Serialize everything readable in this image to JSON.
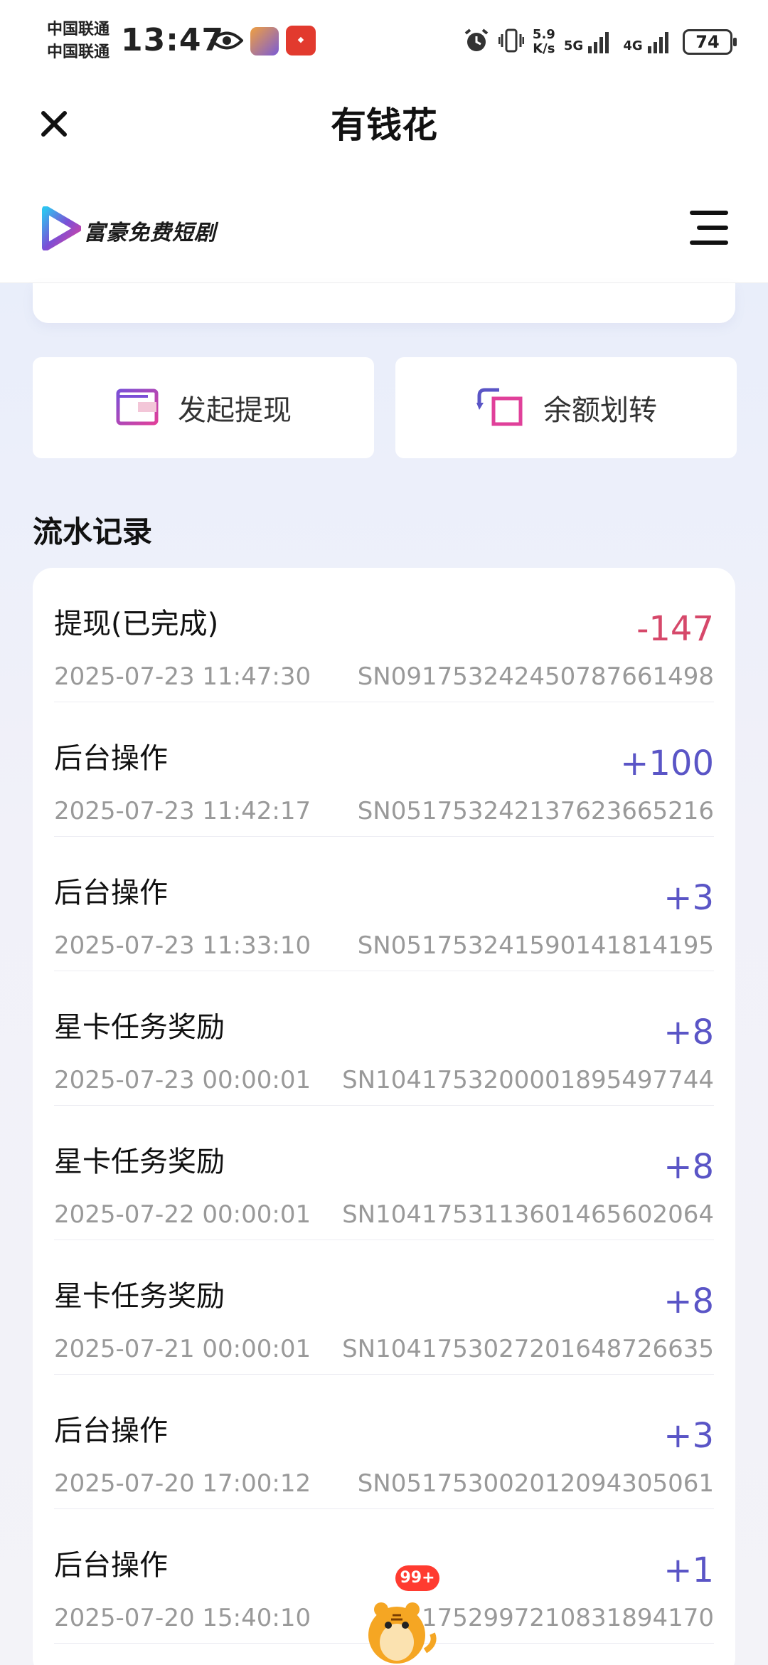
{
  "statusbar": {
    "carrier1": "中国联通",
    "carrier2": "中国联通",
    "time": "13:47",
    "speed_value": "5.9",
    "speed_unit": "K/s",
    "net1": "5G",
    "net2": "4G",
    "battery": "74"
  },
  "nav": {
    "title": "有钱花"
  },
  "app": {
    "logo_text": "富豪免费短剧"
  },
  "actions": {
    "withdraw_label": "发起提现",
    "transfer_label": "余额划转"
  },
  "section": {
    "title": "流水记录"
  },
  "records": [
    {
      "title": "提现(已完成)",
      "amount": "-147",
      "time": "2025-07-23 11:47:30",
      "sn": "SN0917532424507876614​98"
    },
    {
      "title": "后台操作",
      "amount": "+100",
      "time": "2025-07-23 11:42:17",
      "sn": "SN051753242137623665216"
    },
    {
      "title": "后台操作",
      "amount": "+3",
      "time": "2025-07-23 11:33:10",
      "sn": "SN051753241590141814195"
    },
    {
      "title": "星卡任务奖励",
      "amount": "+8",
      "time": "2025-07-23 00:00:01",
      "sn": "SN1041753200001895497744"
    },
    {
      "title": "星卡任务奖励",
      "amount": "+8",
      "time": "2025-07-22 00:00:01",
      "sn": "SN1041753113601465602064"
    },
    {
      "title": "星卡任务奖励",
      "amount": "+8",
      "time": "2025-07-21 00:00:01",
      "sn": "SN1041753027201648726635"
    },
    {
      "title": "后台操作",
      "amount": "+3",
      "time": "2025-07-20 17:00:12",
      "sn": "SN051753002012094305061"
    },
    {
      "title": "后台操作",
      "amount": "+1",
      "time": "2025-07-20 15:40:10",
      "sn": "51752997210831894170"
    }
  ],
  "floating": {
    "badge": "99+"
  },
  "colors": {
    "negative": "#d6486a",
    "positive": "#5a55c6",
    "accent_purple": "#7b4fd6"
  }
}
